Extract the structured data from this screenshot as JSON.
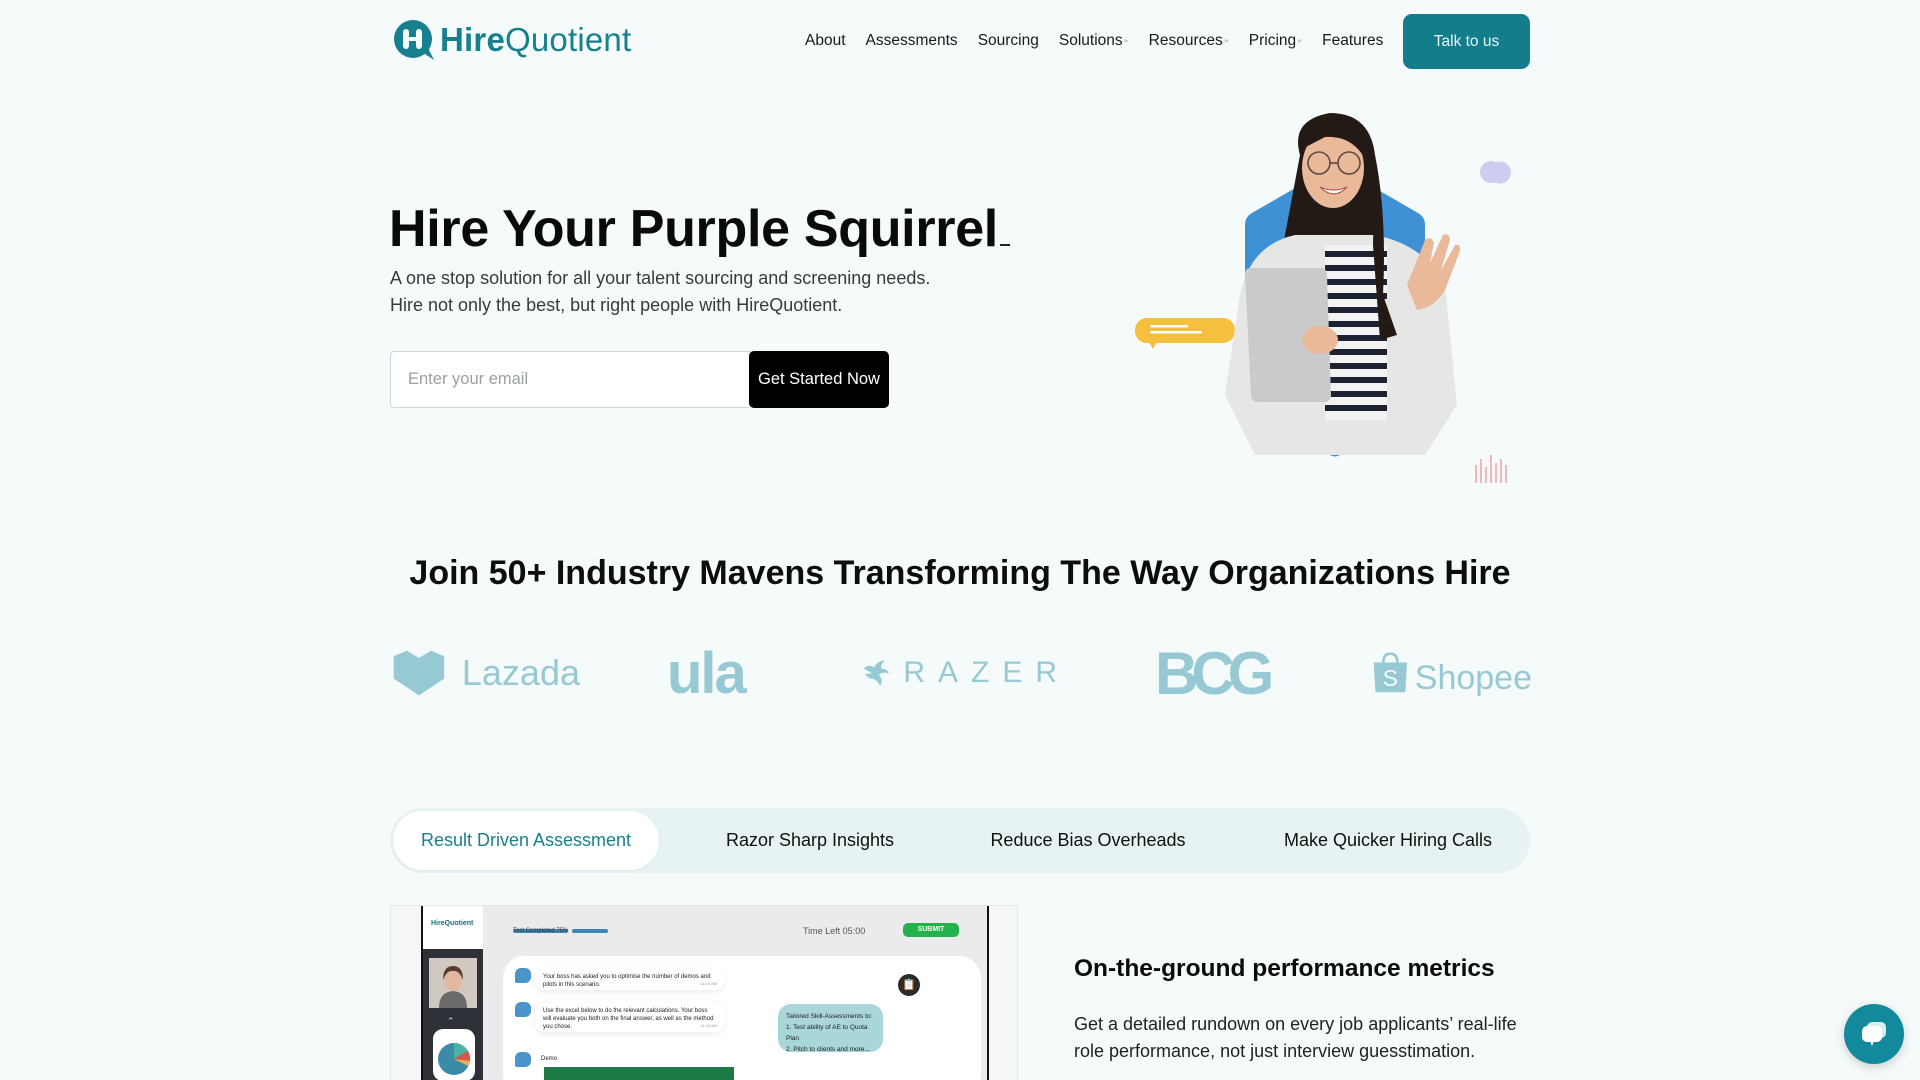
{
  "brand": {
    "name_bold": "Hire",
    "name_regular": "Quotient",
    "accent_color": "#137d8c",
    "logo_icon": "hq-speech-bubble-logo"
  },
  "nav": {
    "items": [
      {
        "label": "About",
        "has_dropdown": false
      },
      {
        "label": "Assessments",
        "has_dropdown": false
      },
      {
        "label": "Sourcing",
        "has_dropdown": false
      },
      {
        "label": "Solutions",
        "has_dropdown": true
      },
      {
        "label": "Resources",
        "has_dropdown": true
      },
      {
        "label": "Pricing",
        "has_dropdown": true
      },
      {
        "label": "Features",
        "has_dropdown": false
      }
    ],
    "cta_label": "Talk to us"
  },
  "hero": {
    "title": "Hire Your Purple Squirrel",
    "subtitle_line1": "A one stop solution for all your talent sourcing and screening needs.",
    "subtitle_line2": "Hire not only the best, but right people with HireQuotient.",
    "email_placeholder": "Enter your email",
    "email_value": "",
    "submit_label": "Get Started Now",
    "image_alt": "Smiling woman with glasses holding a laptop and waving, on blue hexagon",
    "hex_color": "#3d91d4",
    "bubble_color": "#f4c03d"
  },
  "clients": {
    "heading": "Join 50+ Industry Mavens Transforming The Way Organizations Hire",
    "logos": [
      {
        "name": "Lazada",
        "icon": "lazada-heart-icon"
      },
      {
        "name": "ula",
        "icon": ""
      },
      {
        "name": "RAZER",
        "icon": "razer-snake-icon"
      },
      {
        "name": "BCG",
        "icon": ""
      },
      {
        "name": "Shopee",
        "icon": "shopee-bag-icon"
      }
    ],
    "logo_color": "#96c9d3"
  },
  "tabs": {
    "items": [
      {
        "label": "Result Driven Assessment",
        "active": true
      },
      {
        "label": "Razor Sharp Insights",
        "active": false
      },
      {
        "label": "Reduce Bias Overheads",
        "active": false
      },
      {
        "label": "Make Quicker Hiring Calls",
        "active": false
      }
    ]
  },
  "mockup": {
    "logo": "HireQuotient",
    "progress_label": "Test Completed 75%",
    "progress_fraction": 0.75,
    "time_left": "Time Left  05:00",
    "submit": "SUBMIT",
    "messages": [
      {
        "text": "Your boss has asked you to optimise the number of demos and pilots in this scenario.",
        "time": "11:15 AM"
      },
      {
        "text": "Use the excel below to do the relevant calculations. Your boss will evaluate you both on the final answer, as well as the method you chose.",
        "time": "11:16 AM"
      }
    ],
    "tailored_title": "Tailored Skill-Assessments to:",
    "tailored_item1": "1. Test ability of AE to Quota Plan",
    "tailored_item2": "2. Pitch to clients and more...",
    "demo_label": "Demo"
  },
  "feature": {
    "title": "On-the-ground performance metrics",
    "description": "Get a detailed rundown on every job applicants’ real-life role performance, not just interview guesstimation."
  },
  "chat_widget": {
    "icon": "chat-bubbles-icon"
  }
}
